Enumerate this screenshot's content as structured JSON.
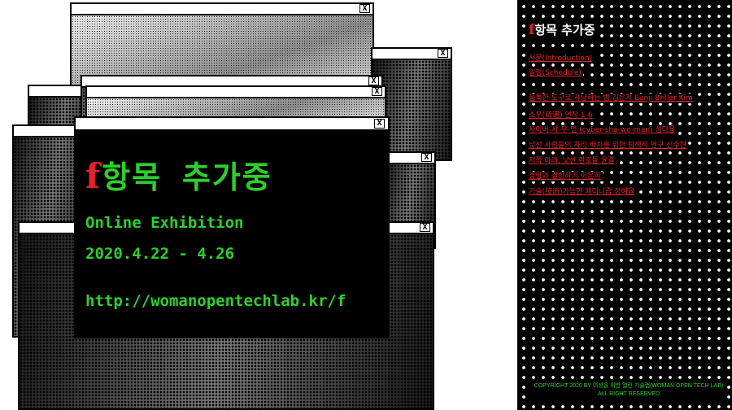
{
  "main_window": {
    "close_label": "X",
    "title_f": "f",
    "title_rest": "항목 추가중",
    "subtitle": "Online Exhibition",
    "dates": "2020.4.22 - 4.26",
    "url": "http://womanopentechlab.kr/f"
  },
  "background_windows": {
    "close_label": "X"
  },
  "panel": {
    "title_f": "f",
    "title_rest": "항목 추가중",
    "menu": [
      {
        "label": "서문(Introduction)"
      },
      {
        "label": "일정(Schedule)"
      },
      {
        "label": "뭉툭한 도구로 사냥하는 법 김은지 Eunji Briller Kim"
      },
      {
        "label": "소우(疏遇) 연작 1-6"
      },
      {
        "label": "사이버-샤-우-먼 (cyber-sha-wo-man) 성다용"
      },
      {
        "label": "낯선 사람들의 자리 배치를 위한 탐색적 연구 신수현"
      },
      {
        "label": "저쪽 아래, 낯선 환호들 윤결"
      },
      {
        "label": "결함과 결합하기 이은희"
      },
      {
        "label": "기술(技術)가능한 페미니즘 정혜윰"
      }
    ],
    "copyright": "COPYRIGHT 2020 BY 여성을 위한 열린 기술랩(WOMAN OPEN TECH LAB) ALL RIGHT RESERVED"
  },
  "colors": {
    "accent_red": "#e8202a",
    "accent_green": "#2bd12b",
    "panel_bg": "#000000"
  }
}
